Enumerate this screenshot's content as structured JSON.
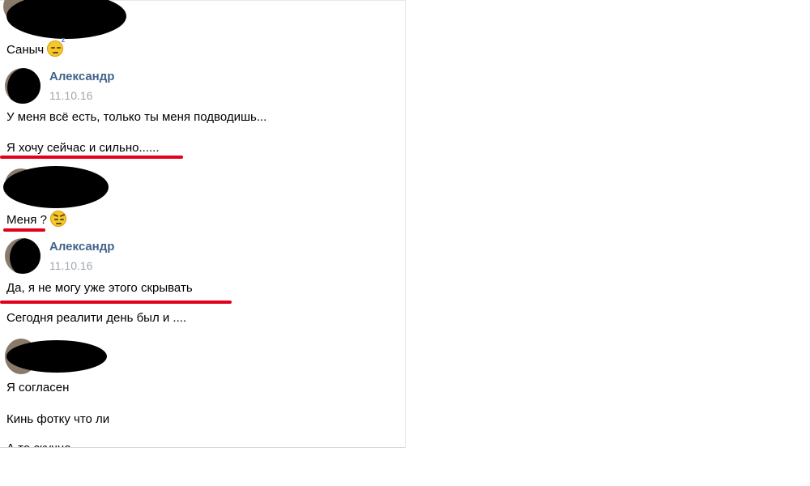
{
  "messages": [
    {
      "type": "text",
      "text": "Саныч",
      "emoji": "sleepy-face-emoji"
    },
    {
      "type": "header",
      "author": "Александр",
      "date": "11.10.16"
    },
    {
      "type": "text",
      "text": "У меня всё есть, только ты меня подводишь..."
    },
    {
      "type": "text",
      "text": "Я хочу сейчас и сильно......",
      "underlined": true
    },
    {
      "type": "text",
      "text": "Меня ?",
      "emoji": "smirking-devil-face-emoji",
      "underlined": true
    },
    {
      "type": "header",
      "author": "Александр",
      "date": "11.10.16"
    },
    {
      "type": "text",
      "text": "Да, я не могу уже этого скрывать",
      "underlined": true
    },
    {
      "type": "text",
      "text": "Сегодня реалити день был и ...."
    },
    {
      "type": "text",
      "text": "Я согласен"
    },
    {
      "type": "text",
      "text": "Кинь фотку что ли"
    },
    {
      "type": "text",
      "text": "А то скучно",
      "clipped": true
    }
  ],
  "colors": {
    "author": "#42648b",
    "date": "#a0a7b0",
    "underline": "#e3001b",
    "redaction": "#000000"
  }
}
